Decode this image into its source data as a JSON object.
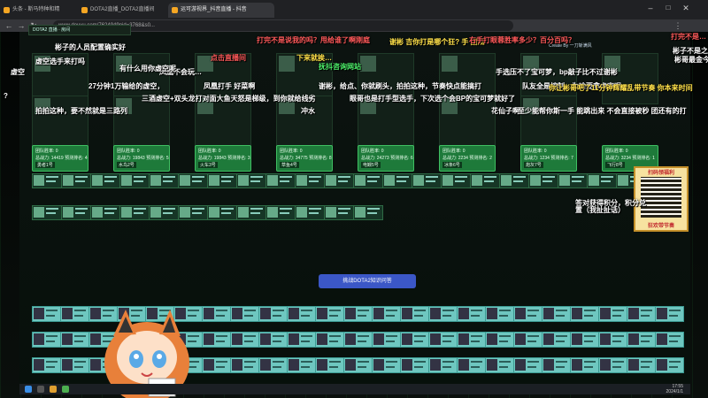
{
  "browser": {
    "tabs": [
      {
        "label": "头条 - 斯马特种和精"
      },
      {
        "label": "DOTA2直播_DOTA2直播间"
      },
      {
        "label": "运可游视界_抖音直播 - 抖音"
      }
    ],
    "url": "www.douyu.com/7624949pid=3768&s0..."
  },
  "stats": [
    {
      "l1": "团队胜率: 0",
      "l2": "总战力: 14419  预测排名: 4",
      "l3": "勇者1号"
    },
    {
      "l1": "团队胜率: 0",
      "l2": "总战力: 19843  预测排名: 5",
      "l3": "水鸟2号"
    },
    {
      "l1": "团队胜率: 0",
      "l2": "总战力: 19843  预测排名: 3",
      "l3": "火车3号"
    },
    {
      "l1": "团队胜率: 0",
      "l2": "总战力: 34775  预测排名: 8",
      "l3": "草鱼4号"
    },
    {
      "l1": "团队胜率: 0",
      "l2": "总战力: 24273  预测排名: 6",
      "l3": "电鳗5号"
    },
    {
      "l1": "团队胜率: 0",
      "l2": "总战力: 2234  预测排名: 2",
      "l3": "冰条6号"
    },
    {
      "l1": "团队胜率: 0",
      "l2": "总战力: 1234  预测排名: 7",
      "l3": "炮灰7号"
    },
    {
      "l1": "团队胜率: 0",
      "l2": "总战力: 3234  预测排名: 1",
      "l3": "飞行8号"
    }
  ],
  "challenge_button": "挑战DOTA2知识问答",
  "danmaku": [
    {
      "text": "彬子的人员配置确实好",
      "color": "w"
    },
    {
      "text": "打完不是说我的吗？甩给谁了啊刚庭",
      "color": "r"
    },
    {
      "text": "谢彬 吉你打是哪个狂? 手 甜瓜",
      "color": "y"
    },
    {
      "text": "右手打眼蓉胜率多少？百分百吗？",
      "color": "r"
    },
    {
      "text": "打完不是…",
      "color": "r"
    },
    {
      "text": "虚空",
      "color": "w"
    },
    {
      "text": "凤凰不会玩…",
      "color": "w"
    },
    {
      "text": "点击直播间",
      "color": "r"
    },
    {
      "text": "下来就挨…",
      "color": "y"
    },
    {
      "text": "手选压不了宝可梦，bp敲子比不过谢彬",
      "color": "w"
    },
    {
      "text": "彬子不是之前…弹+双",
      "color": "w"
    },
    {
      "text": "彬哥最金今",
      "color": "w"
    },
    {
      "text": "虚空选手来打吗",
      "color": "w"
    },
    {
      "text": "27分钟1万输给的虚空，",
      "color": "w"
    },
    {
      "text": "凤凰打手 好菜啊",
      "color": "w"
    },
    {
      "text": "谢彬，给点、你就刷头，拍拍这种，节奏快点能搞打",
      "color": "w"
    },
    {
      "text": "队友全是控制，为啥要拿虚空呢",
      "color": "w"
    },
    {
      "text": "你让彬哥吧了11分钟辉耀乱带节奏 你本来时间",
      "color": "y"
    },
    {
      "text": "三酒虚空+双头龙打对面大鱼天怒是梯级，到你就给线劣",
      "color": "w"
    },
    {
      "text": "冲水",
      "color": "w"
    },
    {
      "text": "眼哥也是打手型选手，下次选个会BP的宝可梦就好了",
      "color": "w"
    },
    {
      "text": "花仙子啊",
      "color": "w"
    },
    {
      "text": "至少能帮你斯一手 能跳出来 不会直接被秒 团还有的打",
      "color": "w"
    },
    {
      "text": "拍拍这种，要不然就是三路列",
      "color": "w"
    },
    {
      "text": "有什么用你虚空呢",
      "color": "w"
    },
    {
      "text": "抚抖咨询网站",
      "color": "g"
    },
    {
      "text": "?",
      "color": "w"
    },
    {
      "text": "答对获得积分，积分兑",
      "color": "w"
    },
    {
      "text": "置（我扯扯话）",
      "color": "w"
    }
  ],
  "qr_title": "扫码领福利",
  "qr_footer": "狂欢带节奏",
  "taskbar": {
    "time": "17:55",
    "date": "2024/1/1"
  },
  "create_by": "Create By 一刀斩满风"
}
